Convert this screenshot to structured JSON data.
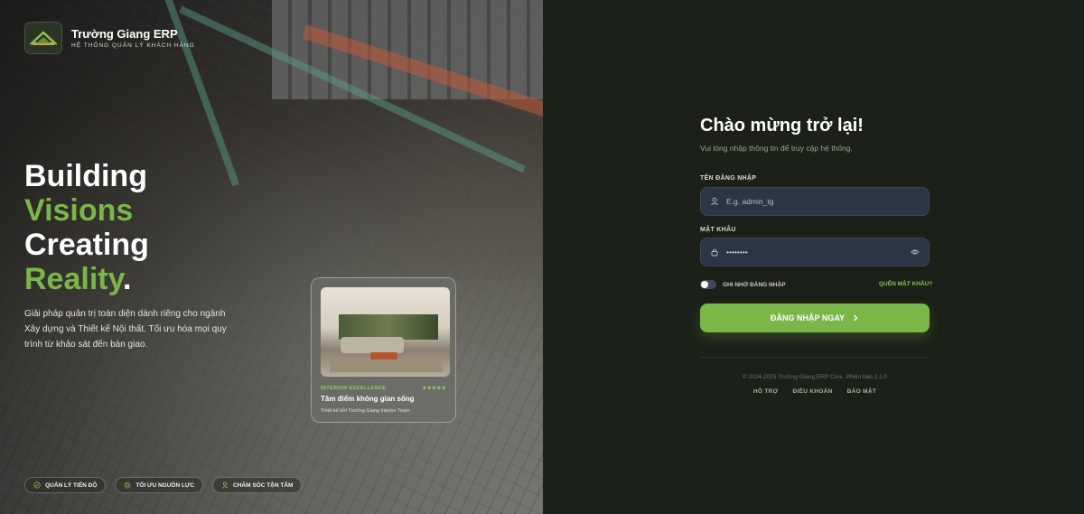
{
  "brand": {
    "name": "Trường Giang ERP",
    "subtitle": "HỆ THỐNG QUẢN LÝ KHÁCH HÀNG",
    "logo_icon": "roof-logo-icon"
  },
  "hero": {
    "headline": {
      "line1": "Building",
      "line2": "Visions",
      "line3": "Creating",
      "line4": "Reality",
      "dot": "."
    },
    "description": "Giải pháp quản trị toàn diện dành riêng cho ngành Xây dựng và Thiết kế Nội thất. Tối ưu hóa mọi quy trình từ khảo sát đến bàn giao.",
    "accent_color": "#7ab648",
    "features": [
      {
        "label": "QUẢN LÝ TIẾN ĐỘ",
        "icon": "check-circle-icon"
      },
      {
        "label": "TỐI ƯU NGUỒN LỰC",
        "icon": "gear-icon"
      },
      {
        "label": "CHĂM SÓC TẬN TÂM",
        "icon": "user-icon"
      }
    ],
    "card": {
      "tag": "INTERIOR EXCELLENCE",
      "stars": "★★★★★",
      "title": "Tâm điểm không gian sống",
      "subtitle": "Thiết kế bởi Trường Giang Interior Team"
    }
  },
  "login": {
    "title": "Chào mừng trở lại!",
    "subtitle": "Vui lòng nhập thông tin để truy cập hệ thống.",
    "username": {
      "label": "TÊN ĐĂNG NHẬP",
      "placeholder": "E.g. admin_tg",
      "value": ""
    },
    "password": {
      "label": "MẬT KHẨU",
      "value": "••••••••"
    },
    "remember_label": "GHI NHỚ ĐĂNG NHẬP",
    "forgot_label": "QUÊN MẬT KHẨU?",
    "submit_label": "ĐĂNG NHẬP NGAY",
    "button_color": "#7ab648"
  },
  "footer": {
    "copyright": "© 2024-2025 Trường Giang ERP Core. Phiên bản 2.1.0",
    "links": [
      "HỖ TRỢ",
      "ĐIỀU KHOẢN",
      "BẢO MẬT"
    ]
  }
}
